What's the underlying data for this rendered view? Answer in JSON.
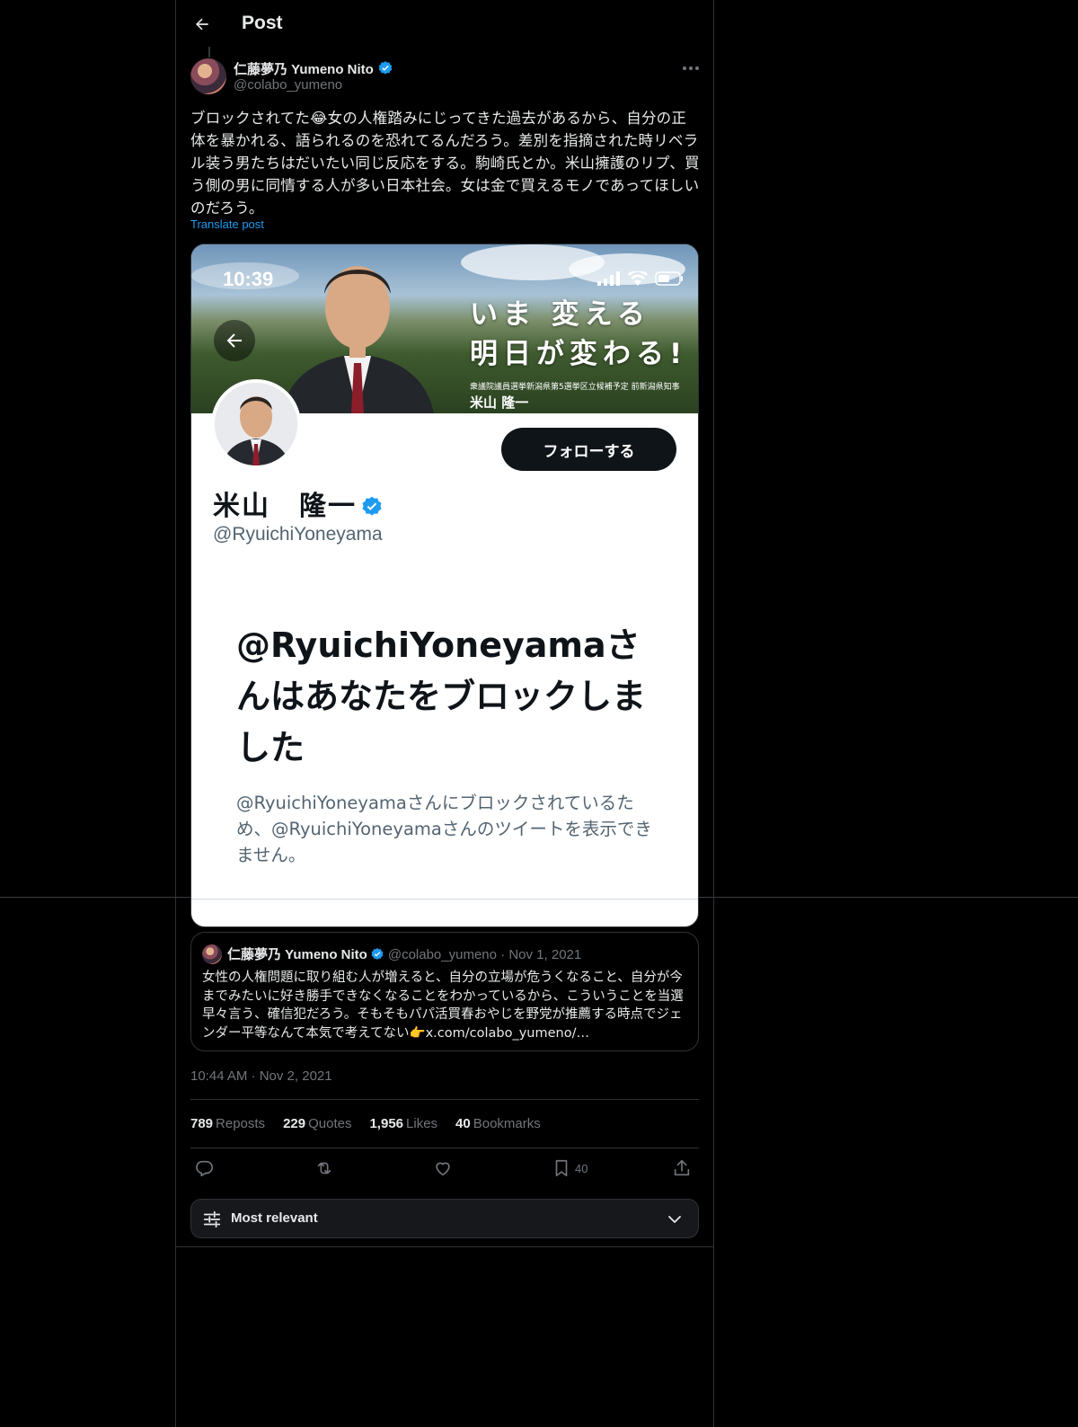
{
  "header": {
    "title": "Post"
  },
  "author": {
    "name": "仁藤夢乃 Yumeno Nito",
    "handle": "@colabo_yumeno"
  },
  "post": {
    "text": "ブロックされてた😂女の人権踏みにじってきた過去があるから、自分の正体を暴かれる、語られるのを恐れてるんだろう。差別を指摘された時リベラル装う男たちはだいたい同じ反応をする。駒崎氏とか。米山擁護のリプ、買う側の男に同情する人が多い日本社会。女は金で買えるモノであってほしいのだろう。",
    "translate_label": "Translate post",
    "timestamp": "10:44 AM · Nov 2, 2021"
  },
  "screenshot": {
    "status_time": "10:39",
    "banner_slogan_1": "いま 変える",
    "banner_slogan_2": "明日が変わる!",
    "banner_sub": "衆議院議員選挙新潟県第5選挙区立候補予定 前新潟県知事",
    "banner_name": "米山 隆一",
    "follow_label": "フォローする",
    "profile_name": "米山　隆一",
    "profile_handle": "@RyuichiYoneyama",
    "blocked_title": "@RyuichiYoneyamaさんはあなたをブロックしました",
    "blocked_desc": "@RyuichiYoneyamaさんにブロックされているため、@RyuichiYoneyamaさんのツイートを表示できません。"
  },
  "quoted": {
    "name": "仁藤夢乃 Yumeno Nito",
    "handle": "@colabo_yumeno",
    "dot": "·",
    "date": "Nov 1, 2021",
    "text": "女性の人権問題に取り組む人が増えると、自分の立場が危うくなること、自分が今までみたいに好き勝手できなくなることをわかっているから、こういうことを当選早々言う、確信犯だろう。そもそもパパ活買春おやじを野党が推薦する時点でジェンダー平等なんて本気で考えてない👉x.com/colabo_yumeno/…"
  },
  "stats": {
    "reposts_count": "789",
    "reposts_label": "Reposts",
    "quotes_count": "229",
    "quotes_label": "Quotes",
    "likes_count": "1,956",
    "likes_label": "Likes",
    "bookmarks_count": "40",
    "bookmarks_label": "Bookmarks"
  },
  "actions": {
    "bookmark_count": "40"
  },
  "sort": {
    "label": "Most relevant"
  },
  "colors": {
    "accent": "#1d9bf0",
    "background": "#000000",
    "muted": "#71767b"
  }
}
